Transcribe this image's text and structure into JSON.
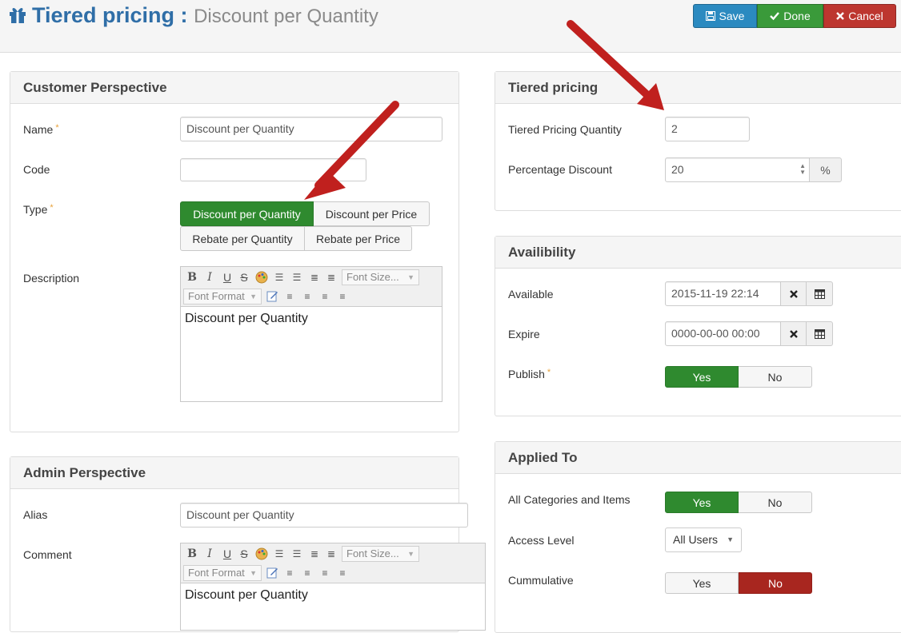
{
  "header": {
    "title": "Tiered pricing :",
    "subtitle": "Discount per Quantity",
    "buttons": {
      "save": "Save",
      "done": "Done",
      "cancel": "Cancel"
    }
  },
  "customer": {
    "heading": "Customer Perspective",
    "name_label": "Name",
    "name_value": "Discount per Quantity",
    "code_label": "Code",
    "code_value": "",
    "type_label": "Type",
    "type_options": [
      "Discount per Quantity",
      "Discount per Price",
      "Rebate per Quantity",
      "Rebate per Price"
    ],
    "type_selected": "Discount per Quantity",
    "description_label": "Description",
    "description_value": "Discount per Quantity"
  },
  "editor": {
    "font_size": "Font Size...",
    "font_format": "Font Format"
  },
  "admin": {
    "heading": "Admin Perspective",
    "alias_label": "Alias",
    "alias_value": "Discount per Quantity",
    "comment_label": "Comment",
    "comment_value": "Discount per Quantity"
  },
  "tiered": {
    "heading": "Tiered pricing",
    "quantity_label": "Tiered Pricing Quantity",
    "quantity_value": "2",
    "discount_label": "Percentage Discount",
    "discount_value": "20",
    "discount_unit": "%"
  },
  "availability": {
    "heading": "Availibility",
    "available_label": "Available",
    "available_value": "2015-11-19 22:14",
    "expire_label": "Expire",
    "expire_value": "0000-00-00 00:00",
    "publish_label": "Publish",
    "yes": "Yes",
    "no": "No",
    "publish_value": "Yes"
  },
  "applied": {
    "heading": "Applied To",
    "all_label": "All Categories and Items",
    "all_value": "Yes",
    "access_label": "Access Level",
    "access_value": "All Users",
    "cumulative_label": "Cummulative",
    "cumulative_value": "No",
    "yes": "Yes",
    "no": "No"
  },
  "colors": {
    "brand_blue": "#2f6ea7",
    "active_green": "#2f8a2f",
    "active_red": "#a8261f",
    "annotation_arrow": "#c0201e"
  },
  "icons": [
    "gift-icon",
    "floppy-icon",
    "check-icon",
    "x-icon",
    "clear-icon",
    "calendar-icon",
    "arrow-annotation"
  ]
}
